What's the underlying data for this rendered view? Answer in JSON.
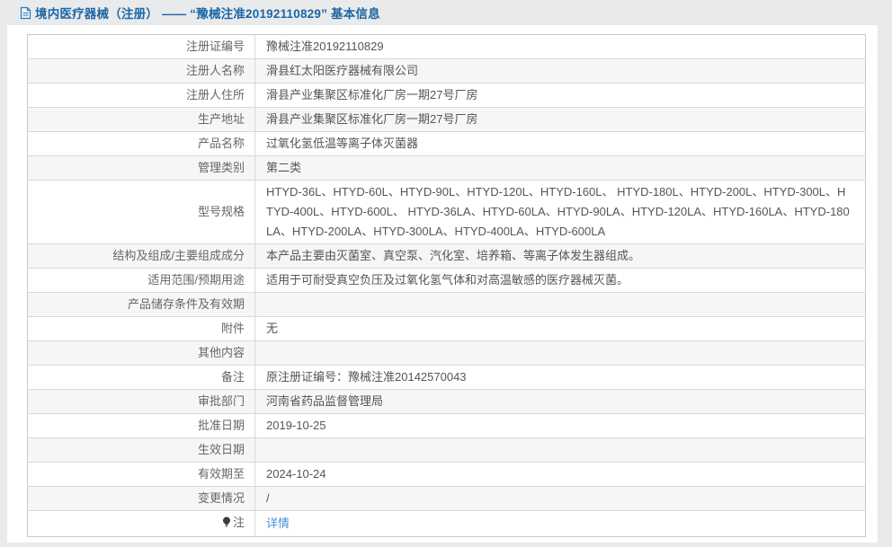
{
  "header": {
    "title": "境内医疗器械（注册） —— “豫械注准20192110829” 基本信息",
    "icon": "document-icon"
  },
  "colors": {
    "title_blue": "#1b66a5",
    "link_blue": "#4a90d9",
    "page_background": "#e8eaec",
    "row_alt_background": "#f6f6f7",
    "border_grey": "#c6c8ca",
    "label_grey": "#666666",
    "value_grey": "#555555"
  },
  "table": {
    "rows": [
      {
        "label": "注册证编号",
        "value": "豫械注准20192110829"
      },
      {
        "label": "注册人名称",
        "value": "滑县红太阳医疗器械有限公司"
      },
      {
        "label": "注册人住所",
        "value": "滑县产业集聚区标准化厂房一期27号厂房"
      },
      {
        "label": "生产地址",
        "value": "滑县产业集聚区标准化厂房一期27号厂房"
      },
      {
        "label": "产品名称",
        "value": "过氧化氢低温等离子体灭菌器"
      },
      {
        "label": "管理类别",
        "value": "第二类"
      },
      {
        "label": "型号规格",
        "value": "HTYD-36L、HTYD-60L、HTYD-90L、HTYD-120L、HTYD-160L、 HTYD-180L、HTYD-200L、HTYD-300L、HTYD-400L、HTYD-600L、 HTYD-36LA、HTYD-60LA、HTYD-90LA、HTYD-120LA、HTYD-160LA、HTYD-180LA、HTYD-200LA、HTYD-300LA、HTYD-400LA、HTYD-600LA"
      },
      {
        "label": "结构及组成/主要组成成分",
        "value": "本产品主要由灭菌室、真空泵、汽化室、培养箱、等离子体发生器组成。"
      },
      {
        "label": "适用范围/预期用途",
        "value": "适用于可耐受真空负压及过氧化氢气体和对高温敏感的医疗器械灭菌。"
      },
      {
        "label": "产品储存条件及有效期",
        "value": ""
      },
      {
        "label": "附件",
        "value": "无"
      },
      {
        "label": "其他内容",
        "value": ""
      },
      {
        "label": "备注",
        "value": "原注册证编号：豫械注准20142570043"
      },
      {
        "label": "审批部门",
        "value": "河南省药品监督管理局"
      },
      {
        "label": "批准日期",
        "value": "2019-10-25"
      },
      {
        "label": "生效日期",
        "value": ""
      },
      {
        "label": "有效期至",
        "value": "2024-10-24"
      },
      {
        "label": "变更情况",
        "value": "/"
      },
      {
        "label": "注",
        "value": "详情",
        "icon": "lightbulb-icon",
        "is_link": true
      }
    ]
  }
}
